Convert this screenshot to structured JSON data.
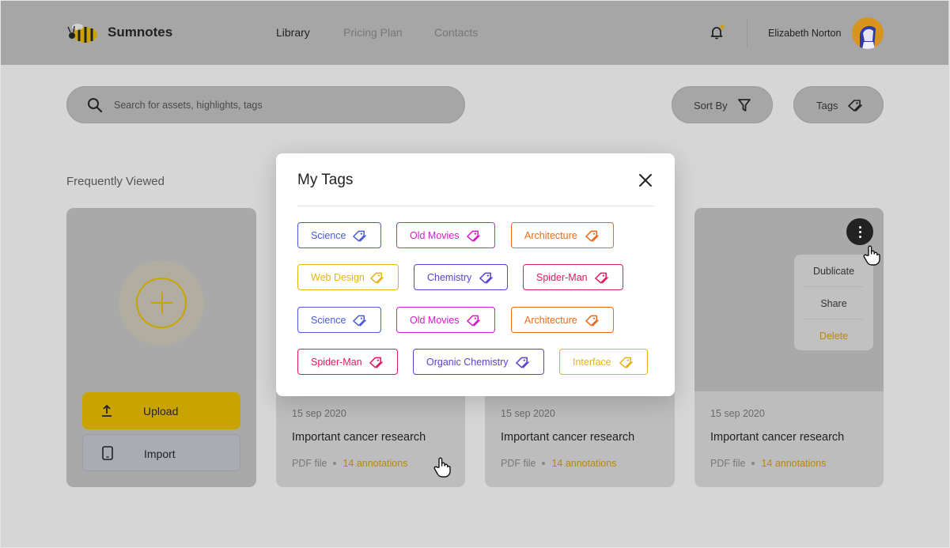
{
  "header": {
    "brand": "Sumnotes",
    "nav": [
      "Library",
      "Pricing Plan",
      "Contacts"
    ],
    "user_name": "Elizabeth Norton"
  },
  "search": {
    "placeholder": "Search for assets, highlights, tags"
  },
  "toolbar": {
    "sort_label": "Sort By",
    "tags_label": "Tags"
  },
  "section": {
    "title": "Frequently Viewed"
  },
  "upload_card": {
    "upload_label": "Upload",
    "import_label": "Import"
  },
  "cards": [
    {
      "date": "15 sep 2020",
      "title": "Important cancer research",
      "type": "PDF file",
      "annotations": "14 annotations"
    },
    {
      "date": "15 sep 2020",
      "title": "Important cancer research",
      "type": "PDF file",
      "annotations": "14 annotations"
    },
    {
      "date": "15 sep 2020",
      "title": "Important cancer research",
      "type": "PDF file",
      "annotations": "14 annotations"
    }
  ],
  "context_menu": {
    "items": [
      "Dublicate",
      "Share",
      "Delete"
    ],
    "danger_color": "#b8860b"
  },
  "modal": {
    "title": "My Tags",
    "tags": [
      {
        "label": "Science",
        "color": "#4a5bd6"
      },
      {
        "label": "Old Movies",
        "color": "#d41bd0"
      },
      {
        "label": "Architecture",
        "color": "#e86a1a"
      },
      {
        "label": "Web Design",
        "color": "#e8b213"
      },
      {
        "label": "Chemistry",
        "color": "#5b3fd0"
      },
      {
        "label": "Spider-Man",
        "color": "#e2195a"
      },
      {
        "label": "Science",
        "color": "#4a5bd6"
      },
      {
        "label": "Old Movies",
        "color": "#d41bd0"
      },
      {
        "label": "Architecture",
        "color": "#e86a1a"
      },
      {
        "label": "Spider-Man",
        "color": "#e2195a"
      },
      {
        "label": "Organic Chemistry",
        "color": "#5b3fd0"
      },
      {
        "label": "Interface",
        "color": "#e8b213"
      }
    ]
  },
  "colors": {
    "accent": "#c9a400",
    "overlay": "#a6a6a6"
  }
}
